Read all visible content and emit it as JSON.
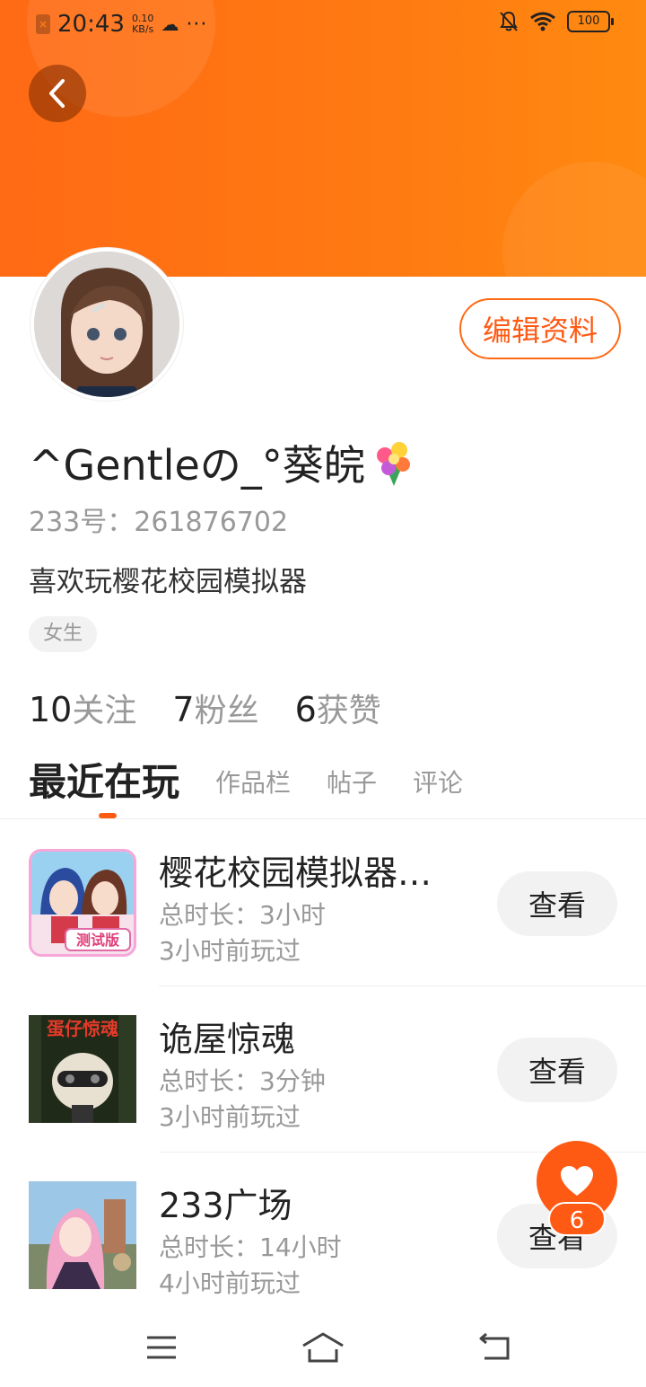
{
  "status_bar": {
    "time": "20:43",
    "net_speed_top": "0.10",
    "net_speed_bottom": "KB/s",
    "battery": "100"
  },
  "profile": {
    "nickname": "^Gentleの_°葵皖",
    "uid": "233号：261876702",
    "bio": "喜欢玩樱花校园模拟器",
    "gender_tag": "女生",
    "edit_label": "编辑资料"
  },
  "stats": [
    {
      "count": "10",
      "label": "关注"
    },
    {
      "count": "7",
      "label": "粉丝"
    },
    {
      "count": "6",
      "label": "获赞"
    }
  ],
  "tabs": [
    {
      "label": "最近在玩",
      "active": true
    },
    {
      "label": "作品栏",
      "active": false
    },
    {
      "label": "帖子",
      "active": false
    },
    {
      "label": "评论",
      "active": false
    }
  ],
  "games": [
    {
      "name": "樱花校园模拟器…",
      "duration": "总时长：3小时",
      "last_played": "3小时前玩过",
      "button": "查看",
      "badge": "测试版"
    },
    {
      "name": "诡屋惊魂",
      "duration": "总时长：3分钟",
      "last_played": "3小时前玩过",
      "button": "查看",
      "badge": "蛋仔惊魂"
    },
    {
      "name": "233广场",
      "duration": "总时长：14小时",
      "last_played": "4小时前玩过",
      "button": "查看"
    }
  ],
  "like_fab": {
    "count": "6"
  },
  "colors": {
    "accent": "#ff5a14",
    "header": "#ff7a12"
  }
}
